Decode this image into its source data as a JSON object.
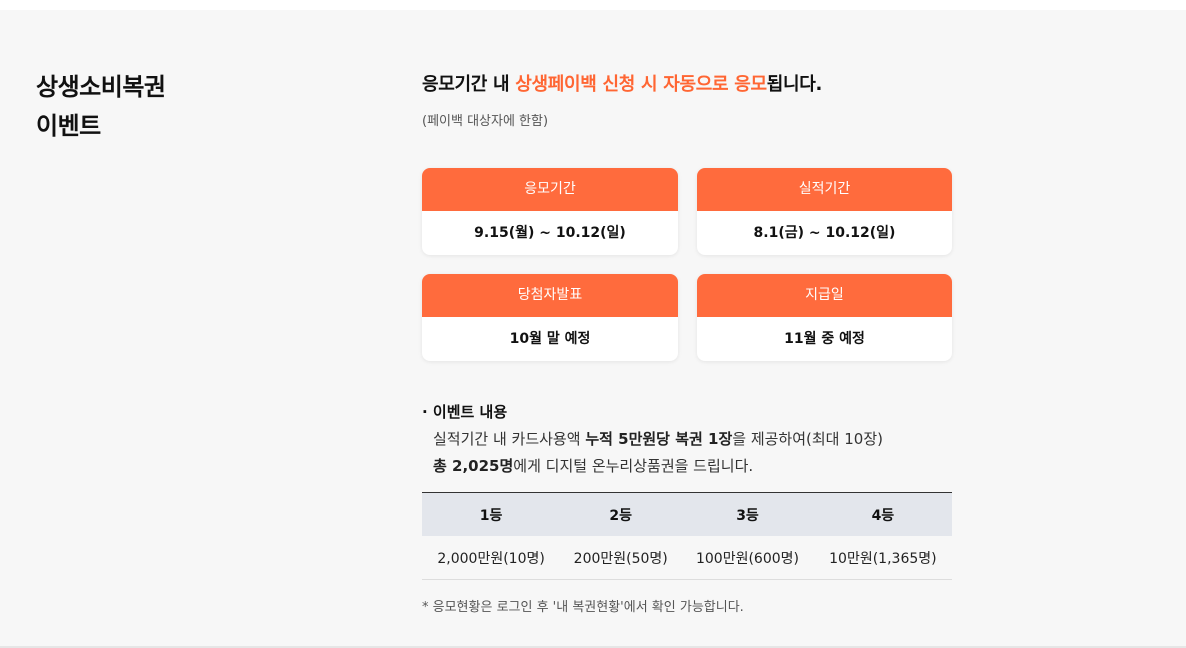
{
  "section": {
    "title_line1": "상생소비복권",
    "title_line2": "이벤트"
  },
  "headline": {
    "part1": "응모기간 내 ",
    "highlight": "상생페이백 신청 시 자동으로 응모",
    "part2": "됩니다.",
    "sub": "(페이백 대상자에 한함)"
  },
  "cards": [
    {
      "label": "응모기간",
      "value": "9.15(월) ~ 10.12(일)"
    },
    {
      "label": "실적기간",
      "value": "8.1(금) ~ 10.12(일)"
    },
    {
      "label": "당첨자발표",
      "value": "10월 말 예정"
    },
    {
      "label": "지급일",
      "value": "11월 중 예정"
    }
  ],
  "event": {
    "title": "· 이벤트 내용",
    "line1_a": "실적기간 내 카드사용액 ",
    "line1_bold": "누적 5만원당 복권 1장",
    "line1_b": "을 제공하여(최대 10장)",
    "line2_bold": "총 2,025명",
    "line2_b": "에게 디지털 온누리상품권을 드립니다."
  },
  "prizes": {
    "headers": [
      "1등",
      "2등",
      "3등",
      "4등"
    ],
    "values": [
      "2,000만원(10명)",
      "200만원(50명)",
      "100만원(600명)",
      "10만원(1,365명)"
    ]
  },
  "note": "* 응모현황은 로그인 후 '내 복권현황'에서 확인 가능합니다.",
  "colors": {
    "accent": "#ff6633",
    "card_header": "#ff6b3d",
    "table_header_bg": "#e3e6ec"
  }
}
